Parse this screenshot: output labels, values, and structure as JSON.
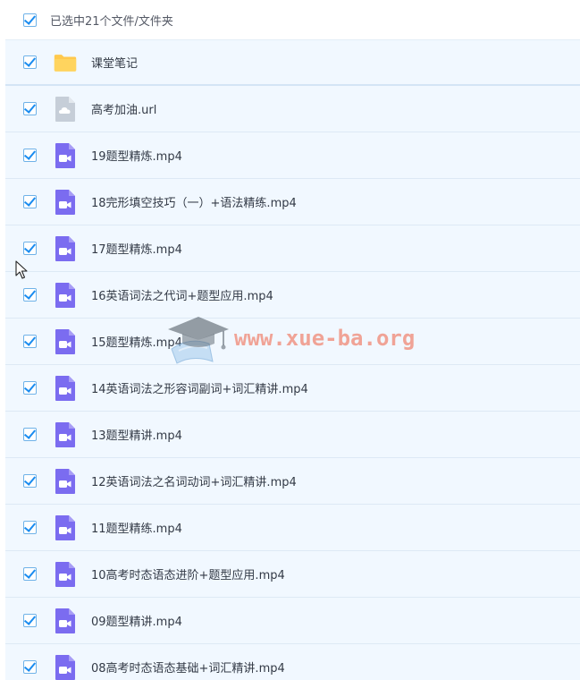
{
  "header": {
    "selection_text": "已选中21个文件/文件夹"
  },
  "files": [
    {
      "name": "课堂笔记",
      "icon": "folder-icon"
    },
    {
      "name": "高考加油.url",
      "icon": "url-file-icon"
    },
    {
      "name": "19题型精炼.mp4",
      "icon": "video-file-icon"
    },
    {
      "name": "18完形填空技巧（一）+语法精练.mp4",
      "icon": "video-file-icon"
    },
    {
      "name": "17题型精炼.mp4",
      "icon": "video-file-icon"
    },
    {
      "name": "16英语词法之代词+题型应用.mp4",
      "icon": "video-file-icon"
    },
    {
      "name": "15题型精炼.mp4",
      "icon": "video-file-icon"
    },
    {
      "name": "14英语词法之形容词副词+词汇精讲.mp4",
      "icon": "video-file-icon"
    },
    {
      "name": "13题型精讲.mp4",
      "icon": "video-file-icon"
    },
    {
      "name": "12英语词法之名词动词+词汇精讲.mp4",
      "icon": "video-file-icon"
    },
    {
      "name": "11题型精练.mp4",
      "icon": "video-file-icon"
    },
    {
      "name": "10高考时态语态进阶+题型应用.mp4",
      "icon": "video-file-icon"
    },
    {
      "name": "09题型精讲.mp4",
      "icon": "video-file-icon"
    },
    {
      "name": "08高考时态语态基础+词汇精讲.mp4",
      "icon": "video-file-icon"
    }
  ],
  "watermark": {
    "text": "www.xue-ba.org"
  },
  "colors": {
    "row_background": "#f1f8ff",
    "checkbox_accent": "#1a8cf0",
    "folder": "#ffc94d",
    "video_icon": "#7b6cf0",
    "url_icon": "#c3ccd6"
  }
}
